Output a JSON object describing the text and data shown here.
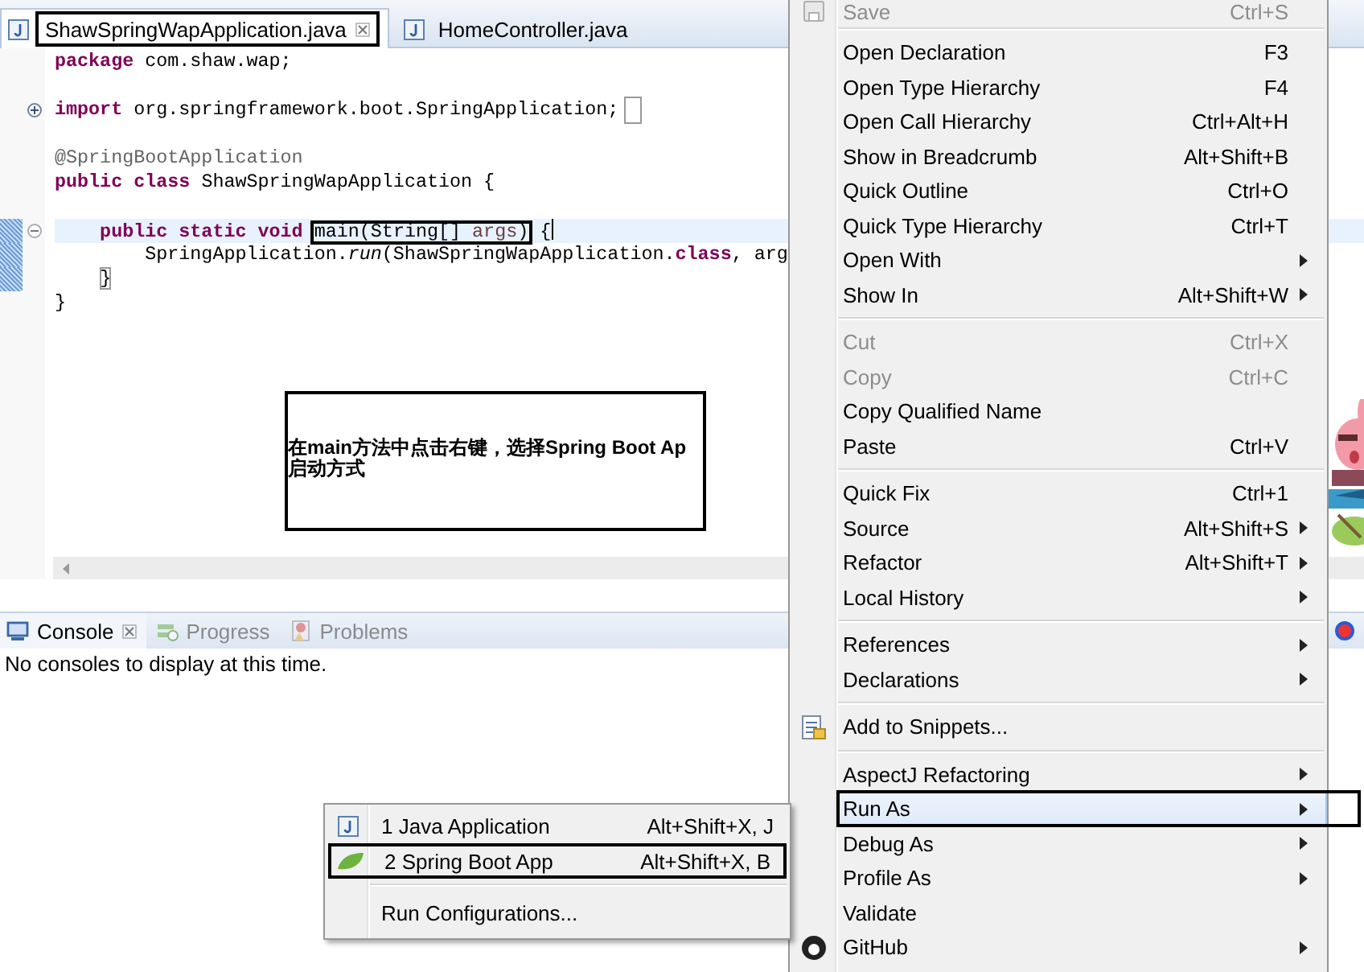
{
  "editor": {
    "tabs": [
      {
        "label": "ShawSpringWapApplication.java",
        "selected": true,
        "closable": true,
        "outlined": true
      },
      {
        "label": "HomeController.java",
        "selected": false,
        "closable": false,
        "outlined": false
      }
    ],
    "lines": [
      {
        "kind": "code",
        "tokens": [
          {
            "text": "package",
            "kind": "keyword"
          },
          {
            "text": " com.shaw.wap;",
            "kind": "plain"
          }
        ]
      },
      {
        "kind": "blank"
      },
      {
        "kind": "code",
        "tokens": [
          {
            "text": "import",
            "kind": "keyword"
          },
          {
            "text": " org.springframework.boot.SpringApplication;",
            "kind": "plain"
          }
        ],
        "folded": true
      },
      {
        "kind": "blank"
      },
      {
        "kind": "code",
        "tokens": [
          {
            "text": "@SpringBootApplication",
            "kind": "annotation"
          }
        ]
      },
      {
        "kind": "code",
        "tokens": [
          {
            "text": "public",
            "kind": "keyword"
          },
          {
            "text": " class",
            "kind": "keyword"
          },
          {
            "text": " ShawSpringWapApplication {",
            "kind": "plain"
          }
        ]
      },
      {
        "kind": "blank"
      },
      {
        "kind": "code",
        "tokens": [
          {
            "text": "    public",
            "kind": "keyword"
          },
          {
            "text": " static",
            "kind": "keyword"
          },
          {
            "text": " void ",
            "kind": "keyword"
          },
          {
            "kind": "framed",
            "tokens": [
              {
                "text": "main(String[] ",
                "kind": "plain"
              },
              {
                "text": "args",
                "kind": "param"
              },
              {
                "text": ")",
                "kind": "plain"
              }
            ]
          },
          {
            "text": " {",
            "kind": "plain"
          }
        ],
        "folded": false,
        "current": true,
        "marker": true,
        "cursor": true
      },
      {
        "kind": "code",
        "tokens": [
          {
            "text": "        SpringApplication.",
            "kind": "plain"
          },
          {
            "text": "run",
            "kind": "italic"
          },
          {
            "text": "(ShawSpringWapApplication.",
            "kind": "plain"
          },
          {
            "text": "class",
            "kind": "keyword"
          },
          {
            "text": ", arg",
            "kind": "plain"
          }
        ],
        "marker": true
      },
      {
        "kind": "code",
        "tokens": [
          {
            "text": "    }",
            "kind": "bracket_match"
          }
        ],
        "marker": true
      },
      {
        "kind": "code",
        "tokens": [
          {
            "text": "}",
            "kind": "plain"
          }
        ]
      }
    ]
  },
  "callout": {
    "lines": [
      "在main方法中点击右键，选择Spring Boot Ap",
      "启动方式"
    ]
  },
  "console": {
    "tabs": [
      {
        "label": "Console",
        "selected": true,
        "closable": true
      },
      {
        "label": "Progress",
        "selected": false,
        "closable": false
      },
      {
        "label": "Problems",
        "selected": false,
        "closable": false
      }
    ],
    "message": "No consoles to display at this time."
  },
  "context_menu": {
    "groups": [
      {
        "items": [
          {
            "label": "Save",
            "shortcut": "Ctrl+S",
            "submenu": false,
            "disabled": true,
            "selected": false,
            "outlined": false
          }
        ]
      },
      {
        "items": [
          {
            "label": "Open Declaration",
            "shortcut": "F3",
            "submenu": false,
            "disabled": false,
            "selected": false,
            "outlined": false
          },
          {
            "label": "Open Type Hierarchy",
            "shortcut": "F4",
            "submenu": false,
            "disabled": false,
            "selected": false,
            "outlined": false
          },
          {
            "label": "Open Call Hierarchy",
            "shortcut": "Ctrl+Alt+H",
            "submenu": false,
            "disabled": false,
            "selected": false,
            "outlined": false
          },
          {
            "label": "Show in Breadcrumb",
            "shortcut": "Alt+Shift+B",
            "submenu": false,
            "disabled": false,
            "selected": false,
            "outlined": false
          },
          {
            "label": "Quick Outline",
            "shortcut": "Ctrl+O",
            "submenu": false,
            "disabled": false,
            "selected": false,
            "outlined": false
          },
          {
            "label": "Quick Type Hierarchy",
            "shortcut": "Ctrl+T",
            "submenu": false,
            "disabled": false,
            "selected": false,
            "outlined": false
          },
          {
            "label": "Open With",
            "submenu": true,
            "disabled": false,
            "selected": false,
            "outlined": false
          },
          {
            "label": "Show In",
            "shortcut": "Alt+Shift+W",
            "submenu": true,
            "disabled": false,
            "selected": false,
            "outlined": false
          }
        ]
      },
      {
        "items": [
          {
            "label": "Cut",
            "shortcut": "Ctrl+X",
            "submenu": false,
            "disabled": true,
            "selected": false,
            "outlined": false
          },
          {
            "label": "Copy",
            "shortcut": "Ctrl+C",
            "submenu": false,
            "disabled": true,
            "selected": false,
            "outlined": false
          },
          {
            "label": "Copy Qualified Name",
            "submenu": false,
            "disabled": false,
            "selected": false,
            "outlined": false
          },
          {
            "label": "Paste",
            "shortcut": "Ctrl+V",
            "submenu": false,
            "disabled": false,
            "selected": false,
            "outlined": false
          }
        ]
      },
      {
        "items": [
          {
            "label": "Quick Fix",
            "shortcut": "Ctrl+1",
            "submenu": false,
            "disabled": false,
            "selected": false,
            "outlined": false
          },
          {
            "label": "Source",
            "shortcut": "Alt+Shift+S",
            "submenu": true,
            "disabled": false,
            "selected": false,
            "outlined": false
          },
          {
            "label": "Refactor",
            "shortcut": "Alt+Shift+T",
            "submenu": true,
            "disabled": false,
            "selected": false,
            "outlined": false
          },
          {
            "label": "Local History",
            "submenu": true,
            "disabled": false,
            "selected": false,
            "outlined": false
          }
        ]
      },
      {
        "items": [
          {
            "label": "References",
            "submenu": true,
            "disabled": false,
            "selected": false,
            "outlined": false
          },
          {
            "label": "Declarations",
            "submenu": true,
            "disabled": false,
            "selected": false,
            "outlined": false
          }
        ]
      },
      {
        "items": [
          {
            "label": "Add to Snippets...",
            "submenu": false,
            "disabled": false,
            "selected": false,
            "outlined": false
          }
        ]
      },
      {
        "items": [
          {
            "label": "AspectJ Refactoring",
            "submenu": true,
            "disabled": false,
            "selected": false,
            "outlined": false
          },
          {
            "label": "Run As",
            "submenu": true,
            "disabled": false,
            "selected": true,
            "outlined": true
          },
          {
            "label": "Debug As",
            "submenu": true,
            "disabled": false,
            "selected": false,
            "outlined": false
          },
          {
            "label": "Profile As",
            "submenu": true,
            "disabled": false,
            "selected": false,
            "outlined": false
          },
          {
            "label": "Validate",
            "submenu": false,
            "disabled": false,
            "selected": false,
            "outlined": false
          },
          {
            "label": "GitHub",
            "submenu": true,
            "disabled": false,
            "selected": false,
            "outlined": false
          }
        ]
      }
    ]
  },
  "run_as_menu": {
    "groups": [
      {
        "items": [
          {
            "label": "1 Java Application",
            "shortcut": "Alt+Shift+X, J",
            "outlined": false
          },
          {
            "label": "2 Spring Boot App",
            "shortcut": "Alt+Shift+X, B",
            "outlined": true
          }
        ]
      },
      {
        "items": [
          {
            "label": "Run Configurations...",
            "outlined": false
          }
        ]
      }
    ]
  }
}
